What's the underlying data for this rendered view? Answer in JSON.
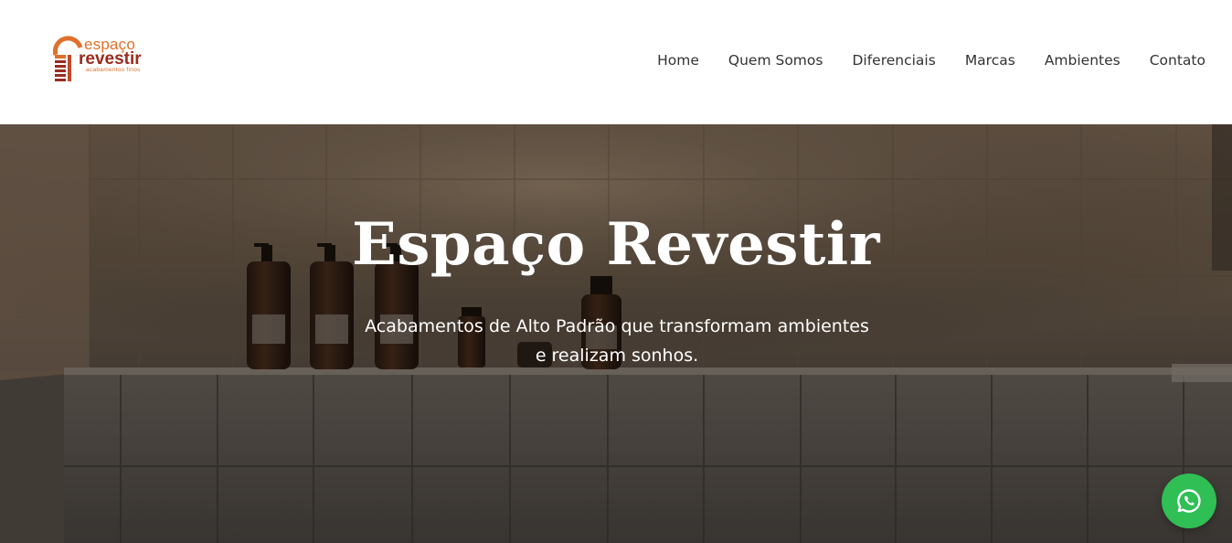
{
  "logo": {
    "word1": "espaço",
    "word2": "revestir",
    "tagline": "acabamentos finos",
    "colors": {
      "orange": "#e0702a",
      "red": "#9b2b1e"
    }
  },
  "nav": {
    "items": [
      {
        "label": "Home"
      },
      {
        "label": "Quem Somos"
      },
      {
        "label": "Diferenciais"
      },
      {
        "label": "Marcas"
      },
      {
        "label": "Ambientes"
      },
      {
        "label": "Contato"
      }
    ]
  },
  "hero": {
    "title": "Espaço Revestir",
    "subtitle_line1": "Acabamentos de Alto Padrão que transformam ambientes",
    "subtitle_line2": "e realizam sonhos."
  },
  "whatsapp": {
    "icon": "whatsapp-icon",
    "color": "#2fbf55"
  }
}
